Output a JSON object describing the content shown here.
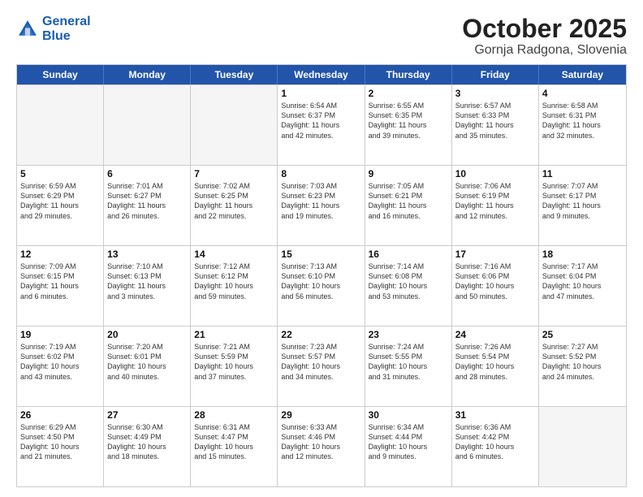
{
  "header": {
    "logo_line1": "General",
    "logo_line2": "Blue",
    "month": "October 2025",
    "location": "Gornja Radgona, Slovenia"
  },
  "weekdays": [
    "Sunday",
    "Monday",
    "Tuesday",
    "Wednesday",
    "Thursday",
    "Friday",
    "Saturday"
  ],
  "rows": [
    [
      {
        "day": "",
        "info": ""
      },
      {
        "day": "",
        "info": ""
      },
      {
        "day": "",
        "info": ""
      },
      {
        "day": "1",
        "info": "Sunrise: 6:54 AM\nSunset: 6:37 PM\nDaylight: 11 hours\nand 42 minutes."
      },
      {
        "day": "2",
        "info": "Sunrise: 6:55 AM\nSunset: 6:35 PM\nDaylight: 11 hours\nand 39 minutes."
      },
      {
        "day": "3",
        "info": "Sunrise: 6:57 AM\nSunset: 6:33 PM\nDaylight: 11 hours\nand 35 minutes."
      },
      {
        "day": "4",
        "info": "Sunrise: 6:58 AM\nSunset: 6:31 PM\nDaylight: 11 hours\nand 32 minutes."
      }
    ],
    [
      {
        "day": "5",
        "info": "Sunrise: 6:59 AM\nSunset: 6:29 PM\nDaylight: 11 hours\nand 29 minutes."
      },
      {
        "day": "6",
        "info": "Sunrise: 7:01 AM\nSunset: 6:27 PM\nDaylight: 11 hours\nand 26 minutes."
      },
      {
        "day": "7",
        "info": "Sunrise: 7:02 AM\nSunset: 6:25 PM\nDaylight: 11 hours\nand 22 minutes."
      },
      {
        "day": "8",
        "info": "Sunrise: 7:03 AM\nSunset: 6:23 PM\nDaylight: 11 hours\nand 19 minutes."
      },
      {
        "day": "9",
        "info": "Sunrise: 7:05 AM\nSunset: 6:21 PM\nDaylight: 11 hours\nand 16 minutes."
      },
      {
        "day": "10",
        "info": "Sunrise: 7:06 AM\nSunset: 6:19 PM\nDaylight: 11 hours\nand 12 minutes."
      },
      {
        "day": "11",
        "info": "Sunrise: 7:07 AM\nSunset: 6:17 PM\nDaylight: 11 hours\nand 9 minutes."
      }
    ],
    [
      {
        "day": "12",
        "info": "Sunrise: 7:09 AM\nSunset: 6:15 PM\nDaylight: 11 hours\nand 6 minutes."
      },
      {
        "day": "13",
        "info": "Sunrise: 7:10 AM\nSunset: 6:13 PM\nDaylight: 11 hours\nand 3 minutes."
      },
      {
        "day": "14",
        "info": "Sunrise: 7:12 AM\nSunset: 6:12 PM\nDaylight: 10 hours\nand 59 minutes."
      },
      {
        "day": "15",
        "info": "Sunrise: 7:13 AM\nSunset: 6:10 PM\nDaylight: 10 hours\nand 56 minutes."
      },
      {
        "day": "16",
        "info": "Sunrise: 7:14 AM\nSunset: 6:08 PM\nDaylight: 10 hours\nand 53 minutes."
      },
      {
        "day": "17",
        "info": "Sunrise: 7:16 AM\nSunset: 6:06 PM\nDaylight: 10 hours\nand 50 minutes."
      },
      {
        "day": "18",
        "info": "Sunrise: 7:17 AM\nSunset: 6:04 PM\nDaylight: 10 hours\nand 47 minutes."
      }
    ],
    [
      {
        "day": "19",
        "info": "Sunrise: 7:19 AM\nSunset: 6:02 PM\nDaylight: 10 hours\nand 43 minutes."
      },
      {
        "day": "20",
        "info": "Sunrise: 7:20 AM\nSunset: 6:01 PM\nDaylight: 10 hours\nand 40 minutes."
      },
      {
        "day": "21",
        "info": "Sunrise: 7:21 AM\nSunset: 5:59 PM\nDaylight: 10 hours\nand 37 minutes."
      },
      {
        "day": "22",
        "info": "Sunrise: 7:23 AM\nSunset: 5:57 PM\nDaylight: 10 hours\nand 34 minutes."
      },
      {
        "day": "23",
        "info": "Sunrise: 7:24 AM\nSunset: 5:55 PM\nDaylight: 10 hours\nand 31 minutes."
      },
      {
        "day": "24",
        "info": "Sunrise: 7:26 AM\nSunset: 5:54 PM\nDaylight: 10 hours\nand 28 minutes."
      },
      {
        "day": "25",
        "info": "Sunrise: 7:27 AM\nSunset: 5:52 PM\nDaylight: 10 hours\nand 24 minutes."
      }
    ],
    [
      {
        "day": "26",
        "info": "Sunrise: 6:29 AM\nSunset: 4:50 PM\nDaylight: 10 hours\nand 21 minutes."
      },
      {
        "day": "27",
        "info": "Sunrise: 6:30 AM\nSunset: 4:49 PM\nDaylight: 10 hours\nand 18 minutes."
      },
      {
        "day": "28",
        "info": "Sunrise: 6:31 AM\nSunset: 4:47 PM\nDaylight: 10 hours\nand 15 minutes."
      },
      {
        "day": "29",
        "info": "Sunrise: 6:33 AM\nSunset: 4:46 PM\nDaylight: 10 hours\nand 12 minutes."
      },
      {
        "day": "30",
        "info": "Sunrise: 6:34 AM\nSunset: 4:44 PM\nDaylight: 10 hours\nand 9 minutes."
      },
      {
        "day": "31",
        "info": "Sunrise: 6:36 AM\nSunset: 4:42 PM\nDaylight: 10 hours\nand 6 minutes."
      },
      {
        "day": "",
        "info": ""
      }
    ]
  ]
}
